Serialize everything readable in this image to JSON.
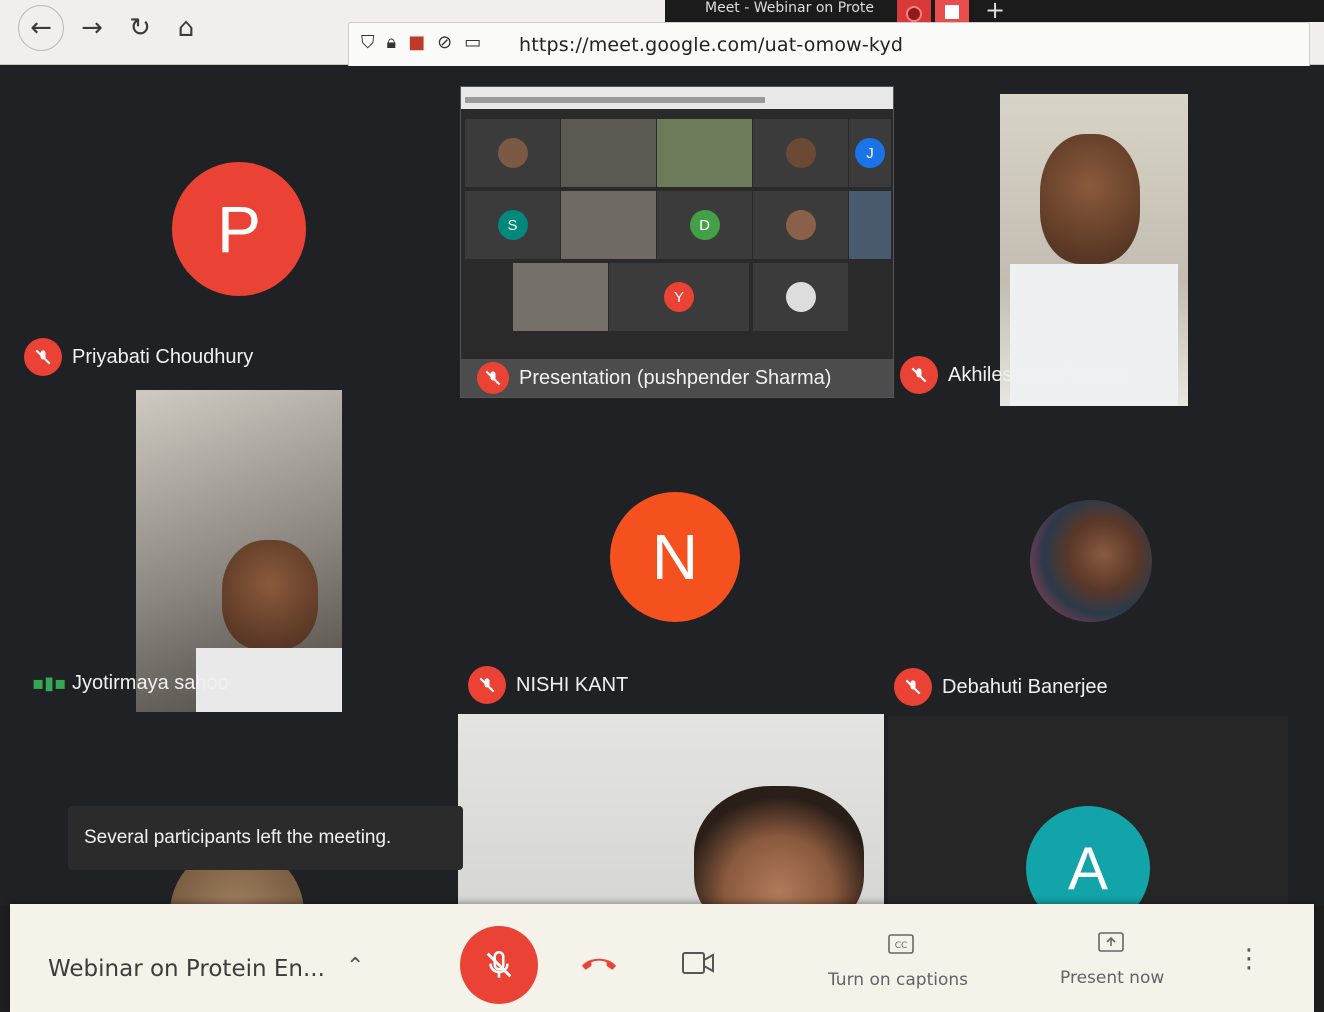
{
  "browser": {
    "url": "https://meet.google.com/uat-omow-kyd",
    "tab_title": "Meet - Webinar on Prote"
  },
  "participants": {
    "p1": {
      "name": "Priyabati Choudhury",
      "initial": "P",
      "color": "#ea4335"
    },
    "presentation": {
      "name": "Presentation (pushpender Sharma)"
    },
    "p3": {
      "name": "Akhileshwar Prasad"
    },
    "p4": {
      "name": "Jyotirmaya sahoo"
    },
    "p5": {
      "name": "NISHI KANT",
      "initial": "N",
      "color": "#f4511e"
    },
    "p6": {
      "name": "Debahuti Banerjee"
    },
    "p7": {
      "initial": "A",
      "color": "#12a4a8"
    }
  },
  "presentation_grid": {
    "initials": [
      "S",
      "D",
      "Y",
      "J"
    ]
  },
  "toast": "Several participants left the meeting.",
  "bottom_bar": {
    "meeting_title": "Webinar on Protein En...",
    "captions_label": "Turn on captions",
    "present_label": "Present now"
  },
  "colors": {
    "accent_red": "#ea4335",
    "bar_bg": "#f5f2ea"
  }
}
